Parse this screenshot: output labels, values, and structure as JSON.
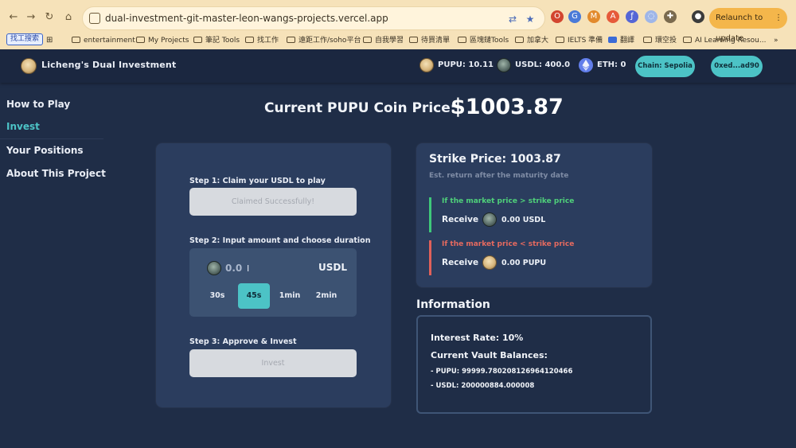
{
  "browser": {
    "url": "dual-investment-git-master-leon-wangs-projects.vercel.app",
    "relaunch_label": "Relaunch to update",
    "nav": {
      "back": "←",
      "forward": "→",
      "reload": "↻",
      "home": "⌂",
      "apps": "⋮⋮"
    },
    "bookmarks": [
      "找工搜索",
      "entertainment",
      "My Projects",
      "筆記 Tools",
      "找工作",
      "遠距工作/soho平台",
      "自我學習",
      "待買清單",
      "區塊鏈Tools",
      "加拿大",
      "IELTS 準備",
      "翻譯",
      "環空投",
      "AI Learning Resou...",
      "»"
    ]
  },
  "header": {
    "brand": "Licheng's Dual Investment",
    "balances": {
      "pupu": "PUPU: 10.11",
      "usdl": "USDL: 400.0",
      "eth": "ETH: 0"
    },
    "chain_button": "Chain: Sepolia",
    "account_button": "0xed...ad90"
  },
  "sidebar": {
    "items": [
      {
        "label": "How to Play",
        "active": false
      },
      {
        "label": "Invest",
        "active": true
      },
      {
        "label": "Your Positions",
        "active": false
      },
      {
        "label": "About This Project",
        "active": false
      }
    ]
  },
  "price": {
    "label": "Current PUPU Coin Price:",
    "value": "$1003.87"
  },
  "invest_card": {
    "step1_label": "Step 1: Claim your USDL to play",
    "step1_button": "Claimed Successfully!",
    "step2_label": "Step 2: Input amount and choose duration",
    "amount_value": "0.0",
    "amount_unit": "USDL",
    "durations": [
      "30s",
      "45s",
      "1min",
      "2min"
    ],
    "selected_duration": "45s",
    "step3_label": "Step 3: Approve & Invest",
    "step3_button": "Invest"
  },
  "strike_card": {
    "title": "Strike Price: 1003.87",
    "subtitle": "Est. return after the maturity date",
    "up": {
      "condition": "If the market price > strike price",
      "receive": "Receive",
      "amount": "0.00 USDL"
    },
    "down": {
      "condition": "If the market price < strike price",
      "receive": "Receive",
      "amount": "0.00 PUPU"
    }
  },
  "information": {
    "title": "Information",
    "interest_rate": "Interest Rate: 10%",
    "vault_title": "Current Vault Balances:",
    "pupu_balance": "- PUPU: 99999.780208126964120466",
    "usdl_balance": "- USDL: 200000884.000008"
  },
  "colors": {
    "accent": "#4cc3c6",
    "background": "#1f2d47",
    "card": "#2b3d5e",
    "up": "#3fc87a",
    "down": "#e0615a"
  }
}
